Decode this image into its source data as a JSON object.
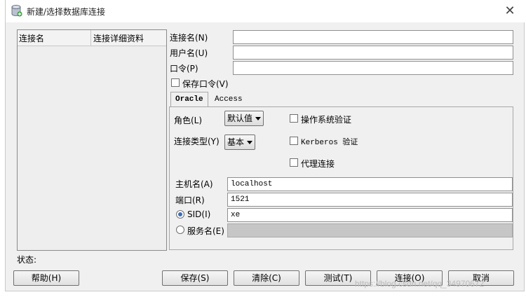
{
  "window": {
    "title": "新建/选择数据库连接"
  },
  "list": {
    "col_name": "连接名",
    "col_detail": "连接详细资料"
  },
  "form": {
    "conn_name_label": "连接名(N)",
    "username_label": "用户名(U)",
    "password_label": "口令(P)",
    "save_password_label": "保存口令(V)",
    "conn_name_value": "",
    "username_value": "",
    "password_value": ""
  },
  "tabs": [
    "Oracle",
    "Access"
  ],
  "oracle": {
    "role_label": "角色(L)",
    "role_value": "默认值",
    "conn_type_label": "连接类型(Y)",
    "conn_type_value": "基本",
    "os_auth_label": "操作系统验证",
    "kerberos_label": "Kerberos 验证",
    "proxy_label": "代理连接",
    "host_label": "主机名(A)",
    "host_value": "localhost",
    "port_label": "端口(R)",
    "port_value": "1521",
    "sid_label": "SID(I)",
    "sid_value": "xe",
    "service_label": "服务名(E)",
    "service_value": ""
  },
  "status_label": "状态:",
  "buttons": {
    "help": "帮助(H)",
    "save": "保存(S)",
    "clear": "清除(C)",
    "test": "测试(T)",
    "connect": "连接(O)",
    "cancel": "取消"
  },
  "watermark": "https://blog.csdn.net/qq_34970672"
}
